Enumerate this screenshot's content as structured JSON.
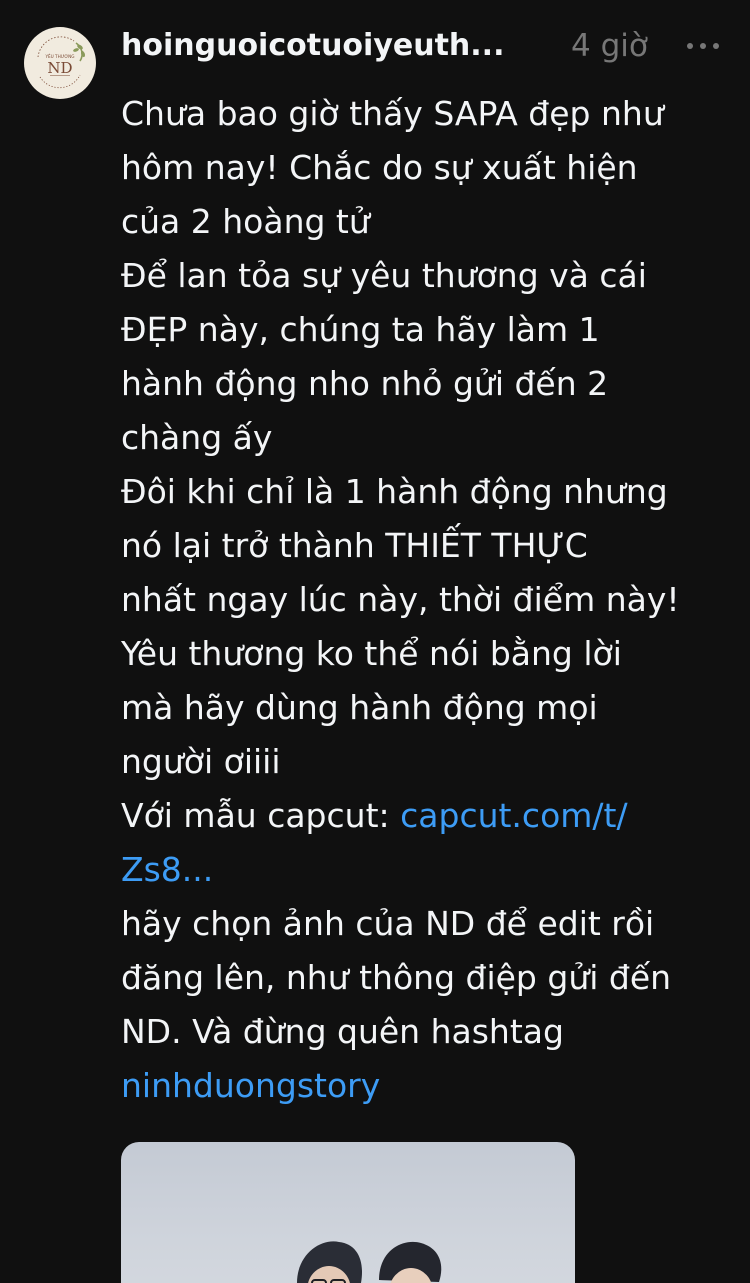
{
  "post": {
    "username": "hoinguoicotuoiyeuth...",
    "time": "4 giờ",
    "avatar": {
      "logo_text_top": "HỘI NGƯỜI CÓ TUỔI",
      "logo_text_middle": "YÊU THƯƠNG",
      "logo_monogram": "ND",
      "logo_text_bottom": "11.10 - 02 - 10 - 20"
    },
    "more_icon": "more-horizontal-icon",
    "text_lines": [
      "Chưa bao giờ thấy SAPA đẹp như",
      "hôm nay! Chắc do sự xuất hiện",
      "của 2 hoàng tử",
      "Để lan tỏa sự yêu thương và cái",
      "ĐẸP này, chúng ta hãy làm 1",
      "hành động nho nhỏ gửi đến 2",
      "chàng ấy",
      "Đôi khi chỉ là 1 hành động nhưng",
      "nó lại trở thành THIẾT THỰC",
      "nhất ngay lúc này, thời điểm này!",
      "Yêu thương ko thể nói bằng lời",
      "mà hãy dùng hành động mọi",
      "người ơiiii"
    ],
    "capcut_prefix": "Với mẫu capcut: ",
    "capcut_link_part1": "capcut.com/t/",
    "capcut_link_part2": "Zs8...",
    "text_lines_2": [
      "hãy chọn ảnh của ND để edit rồi",
      "đăng lên, như thông điệp gửi đến",
      "ND. Và đừng quên hashtag"
    ],
    "hashtag": "ninhduongstory"
  },
  "colors": {
    "background": "#101010",
    "primary_text": "#f3f5f7",
    "secondary_text": "#777777",
    "link": "#3d9cf5",
    "avatar_bg": "#f1ebdf",
    "logo_brown": "#7a4a35",
    "logo_green": "#8a9a5b"
  }
}
